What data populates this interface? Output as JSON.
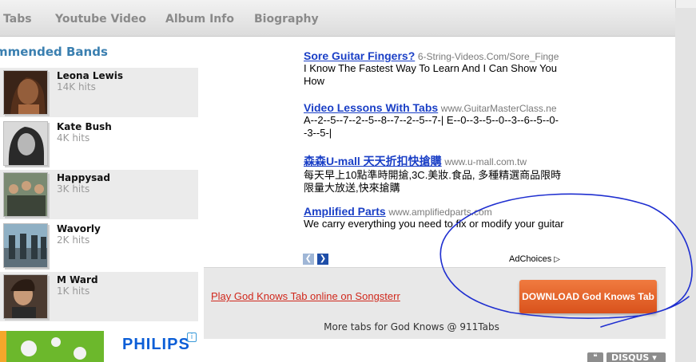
{
  "tabs": [
    {
      "label": "Tabs"
    },
    {
      "label": "Youtube Video"
    },
    {
      "label": "Album Info"
    },
    {
      "label": "Biography"
    }
  ],
  "sidebar": {
    "title": "mmended Bands",
    "bands": [
      {
        "name": "Leona Lewis",
        "hits": "14K hits"
      },
      {
        "name": "Kate Bush",
        "hits": "4K hits"
      },
      {
        "name": "Happysad",
        "hits": "3K hits"
      },
      {
        "name": "Wavorly",
        "hits": "2K hits"
      },
      {
        "name": "M Ward",
        "hits": "1K hits"
      }
    ],
    "ad_brand": "PHILIPS"
  },
  "ads": [
    {
      "title": "Sore Guitar Fingers?",
      "url": "6-String-Videos.Com/Sore_Finge",
      "desc": "I Know The Fastest Way To Learn And I Can Show You How"
    },
    {
      "title": "Video Lessons With Tabs",
      "url": "www.GuitarMasterClass.ne",
      "desc": "A--2--5--7--2--5--8--7--2--5--7-| E--0--3--5--0--3--6--5--0--3--5-|"
    },
    {
      "title": "森森U-mall 天天折扣快搶購",
      "url": "www.u-mall.com.tw",
      "desc": "每天早上10點準時開搶,3C.美妝.食品, 多種精選商品限時限量大放送,快來搶購"
    },
    {
      "title": "Amplified Parts",
      "url": "www.amplifiedparts.com",
      "desc": "We carry everything you need to fix or modify your guitar"
    }
  ],
  "adchoices_label": "AdChoices",
  "tab_box": {
    "songsterr_link": "Play God Knows Tab online on Songsterr",
    "download_label": "DOWNLOAD God Knows Tab",
    "more_tabs": "More tabs for God Knows @ 911Tabs"
  },
  "disqus_label": "DISQUS",
  "colors": {
    "link_blue": "#1a3fc6",
    "sidebar_title": "#3a7fb0",
    "download_orange": "#e0622a",
    "songsterr_red": "#d0281c",
    "annotation_ink": "#1f2fd0"
  }
}
